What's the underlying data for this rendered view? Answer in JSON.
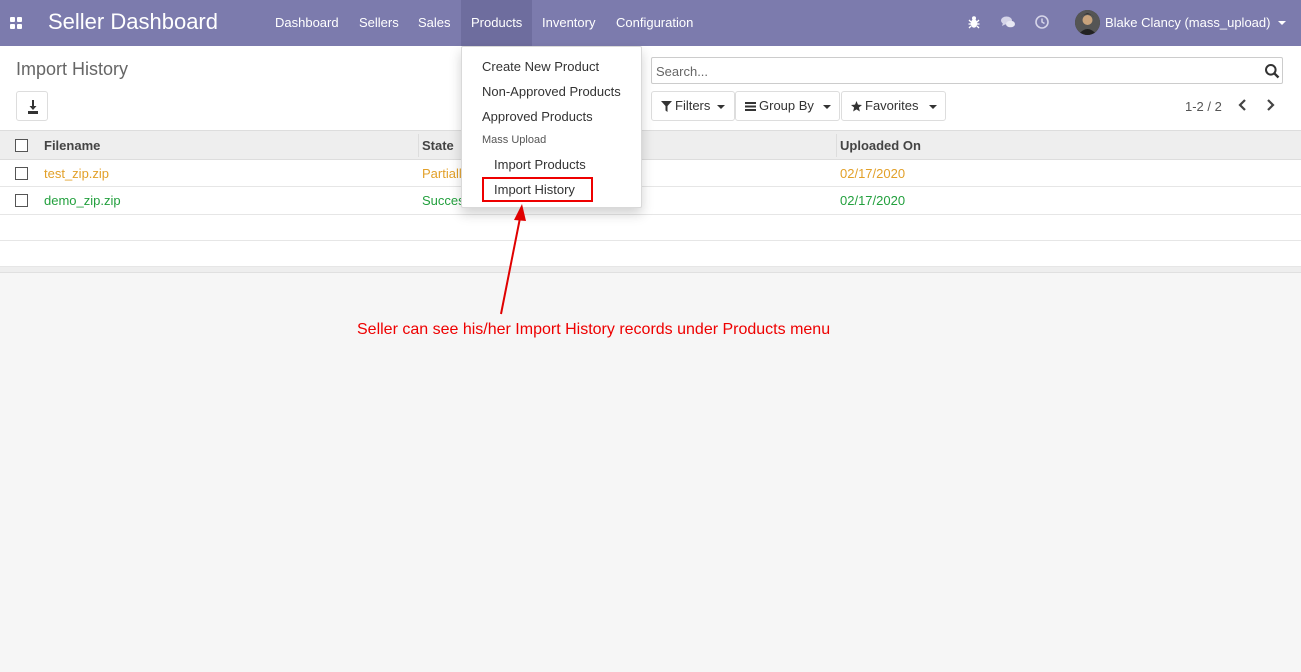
{
  "navbar": {
    "brand": "Seller Dashboard",
    "menu": [
      "Dashboard",
      "Sellers",
      "Sales",
      "Products",
      "Inventory",
      "Configuration"
    ],
    "active_menu": "Products",
    "user_name": "Blake Clancy (mass_upload)",
    "icons": [
      "apps-grid-icon",
      "bug-icon",
      "chat-icon",
      "clock-icon"
    ]
  },
  "control_panel": {
    "title": "Import History",
    "search_placeholder": "Search...",
    "filters_label": "Filters",
    "group_by_label": "Group By",
    "favorites_label": "Favorites",
    "pager_value": "1-2 / 2"
  },
  "table": {
    "columns": [
      "Filename",
      "State",
      "Uploaded On"
    ],
    "rows": [
      {
        "filename": "test_zip.zip",
        "state": "Partially",
        "uploaded_on": "02/17/2020",
        "status_color": "#e2a029"
      },
      {
        "filename": "demo_zip.zip",
        "state": "Success",
        "uploaded_on": "02/17/2020",
        "status_color": "#23a03e"
      }
    ]
  },
  "products_menu": {
    "items": [
      "Create New Product",
      "Non-Approved Products",
      "Approved Products"
    ],
    "section_header": "Mass Upload",
    "sub_items": [
      "Import Products",
      "Import History"
    ]
  },
  "annotation": {
    "text": "Seller can see his/her Import History records under Products menu",
    "color": "#e00000"
  },
  "colors": {
    "navbar": "#7c7bad",
    "navbar_active": "#6e6d9e"
  }
}
